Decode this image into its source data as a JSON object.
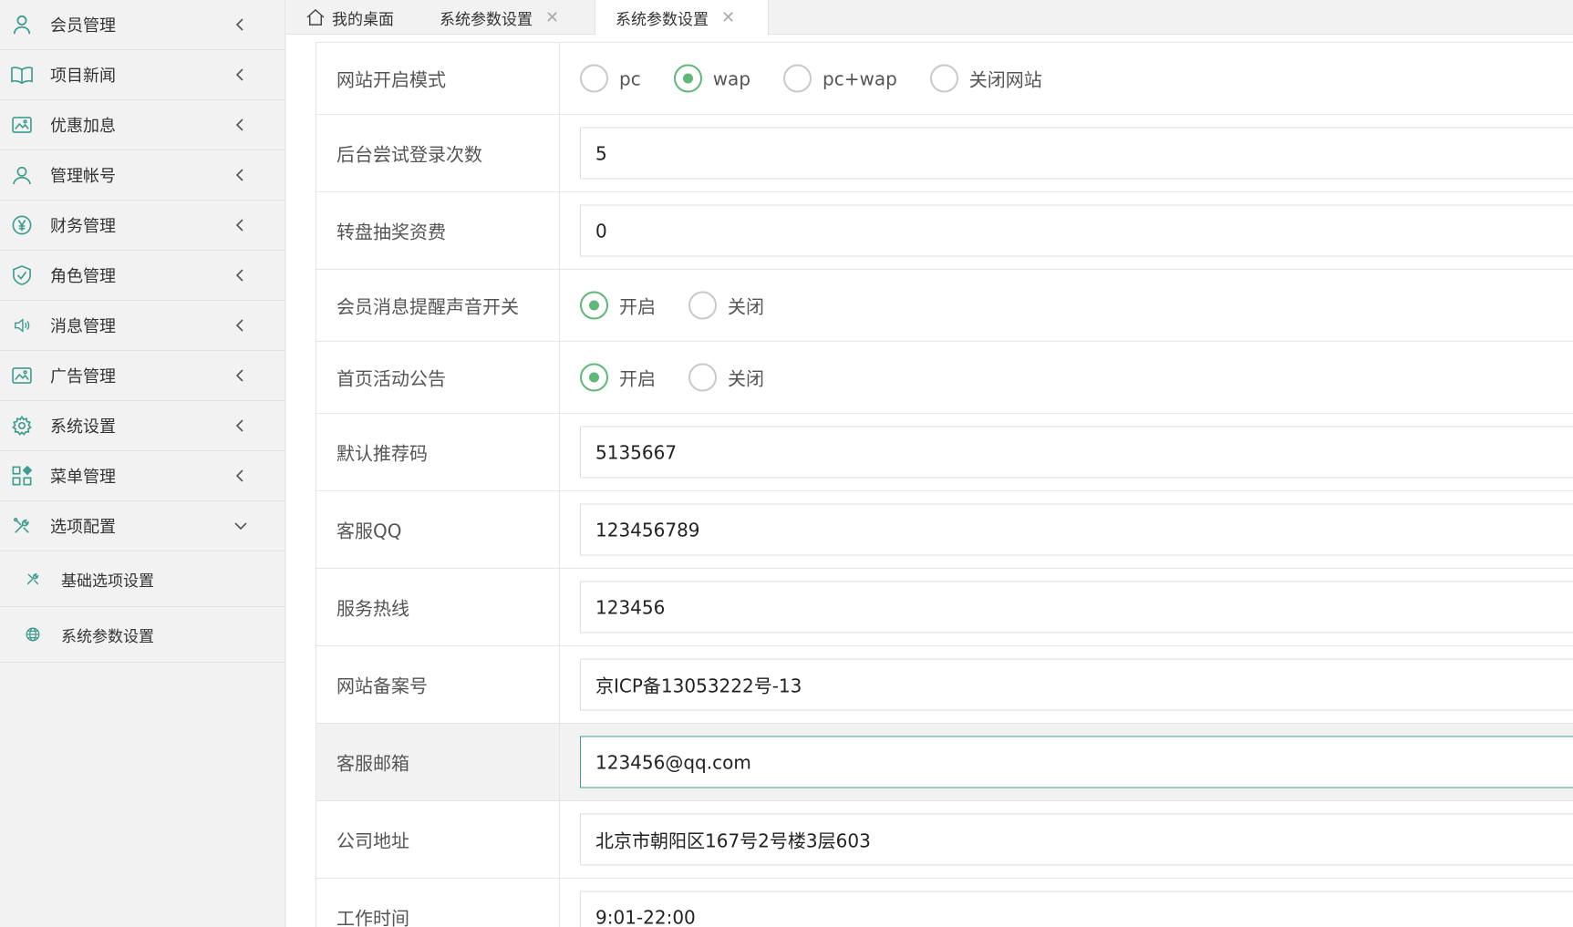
{
  "sidebar": {
    "items": [
      {
        "label": "会员管理",
        "icon": "user-icon"
      },
      {
        "label": "项目新闻",
        "icon": "book-icon"
      },
      {
        "label": "优惠加息",
        "icon": "image-icon"
      },
      {
        "label": "管理帐号",
        "icon": "user-outline-icon"
      },
      {
        "label": "财务管理",
        "icon": "yen-icon"
      },
      {
        "label": "角色管理",
        "icon": "shield-icon"
      },
      {
        "label": "消息管理",
        "icon": "speaker-icon"
      },
      {
        "label": "广告管理",
        "icon": "image-icon"
      },
      {
        "label": "系统设置",
        "icon": "gear-icon"
      },
      {
        "label": "菜单管理",
        "icon": "apps-icon"
      },
      {
        "label": "选项配置",
        "icon": "tools-icon"
      }
    ],
    "subitems": [
      {
        "label": "基础选项设置",
        "icon": "tools-icon"
      },
      {
        "label": "系统参数设置",
        "icon": "globe-icon"
      }
    ]
  },
  "tabs": [
    {
      "label": "我的桌面",
      "icon": "home-icon"
    },
    {
      "label": "系统参数设置",
      "close": "✕"
    },
    {
      "label": "系统参数设置",
      "close": "✕"
    }
  ],
  "form": {
    "site_mode": {
      "label": "网站开启模式",
      "options": [
        "pc",
        "wap",
        "pc+wap",
        "关闭网站"
      ],
      "selected": "wap"
    },
    "login_attempts": {
      "label": "后台尝试登录次数",
      "value": "5"
    },
    "wheel_fee": {
      "label": "转盘抽奖资费",
      "value": "0"
    },
    "msg_sound": {
      "label": "会员消息提醒声音开关",
      "options": [
        "开启",
        "关闭"
      ],
      "selected": "开启"
    },
    "home_notice": {
      "label": "首页活动公告",
      "options": [
        "开启",
        "关闭"
      ],
      "selected": "开启"
    },
    "ref_code": {
      "label": "默认推荐码",
      "value": "5135667"
    },
    "service_qq": {
      "label": "客服QQ",
      "value": "123456789"
    },
    "hotline": {
      "label": "服务热线",
      "value": "123456"
    },
    "icp": {
      "label": "网站备案号",
      "value": "京ICP备13053222号-13"
    },
    "email": {
      "label": "客服邮箱",
      "value": "123456@qq.com"
    },
    "address": {
      "label": "公司地址",
      "value": "北京市朝阳区167号2号楼3层603"
    },
    "work_hours": {
      "label": "工作时间",
      "value": "9:01-22:00"
    }
  },
  "colors": {
    "accent": "#5fb878",
    "icon": "#3e9d8f",
    "focus": "#3e9d8f"
  }
}
